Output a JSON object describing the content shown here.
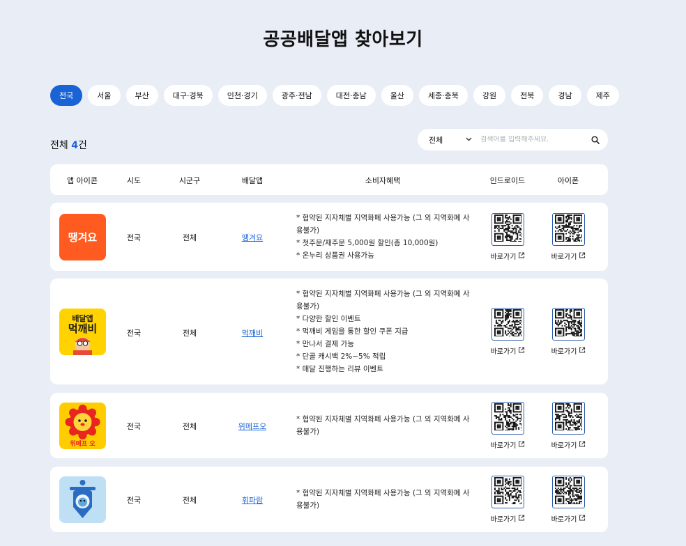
{
  "page": {
    "title": "공공배달앱 찾아보기"
  },
  "regions": [
    {
      "label": "전국",
      "active": true
    },
    {
      "label": "서울"
    },
    {
      "label": "부산"
    },
    {
      "label": "대구·경북"
    },
    {
      "label": "인천·경기"
    },
    {
      "label": "광주·전남"
    },
    {
      "label": "대전·충남"
    },
    {
      "label": "울산"
    },
    {
      "label": "세종·충북"
    },
    {
      "label": "강원"
    },
    {
      "label": "전북"
    },
    {
      "label": "경남"
    },
    {
      "label": "제주"
    }
  ],
  "summary": {
    "label": "전체",
    "count": "4",
    "unit": "건"
  },
  "search": {
    "select_value": "전체",
    "placeholder": "검색어를 입력해주세요."
  },
  "table": {
    "headers": [
      "앱 아이콘",
      "시도",
      "시군구",
      "배달앱",
      "소비자혜택",
      "인드로이드",
      "아이폰"
    ],
    "go_label": "바로가기",
    "rows": [
      {
        "sido": "전국",
        "sigungu": "전체",
        "app": "땡겨요",
        "icon_text": "땡겨요",
        "benefits": [
          "* 협약된 지자체별 지역화폐 사용가능 (그 외 지역화폐 사용불가)",
          "* 첫주문/재주문 5,000원 할인(총 10,000원)",
          "* 온누리 상품권 사용가능"
        ]
      },
      {
        "sido": "전국",
        "sigungu": "전체",
        "app": "먹깨비",
        "icon_text_top": "배달앱",
        "icon_text_main": "먹깨비",
        "benefits": [
          "* 협약된 지자체별 지역화폐 사용가능 (그 외 지역화폐 사용불가)",
          "* 다양한 할인 이벤트",
          "* 먹깨비 게임을 통한 할인 쿠폰 지급",
          "* 만나서 결제 가능",
          "* 단골 캐시백 2%~5% 적립",
          "* 매달 진행하는 리뷰 이벤트"
        ]
      },
      {
        "sido": "전국",
        "sigungu": "전체",
        "app": "위메프오",
        "icon_text": "위메프 오",
        "benefits": [
          "* 협약된 지자체별 지역화폐 사용가능 (그 외 지역화폐 사용불가)"
        ]
      },
      {
        "sido": "전국",
        "sigungu": "전체",
        "app": "휘파람",
        "benefits": [
          "* 협약된 지자체별 지역화폐 사용가능 (그 외 지역화폐 사용불가)"
        ]
      }
    ]
  },
  "colors": {
    "accent": "#1a63d6",
    "background": "#e9eef6",
    "ttaeng": "#ff5a1f",
    "mukkebi": "#ffd200",
    "wemakeprice": "#ffcc00",
    "hwiparam": "#bfe0f4"
  }
}
